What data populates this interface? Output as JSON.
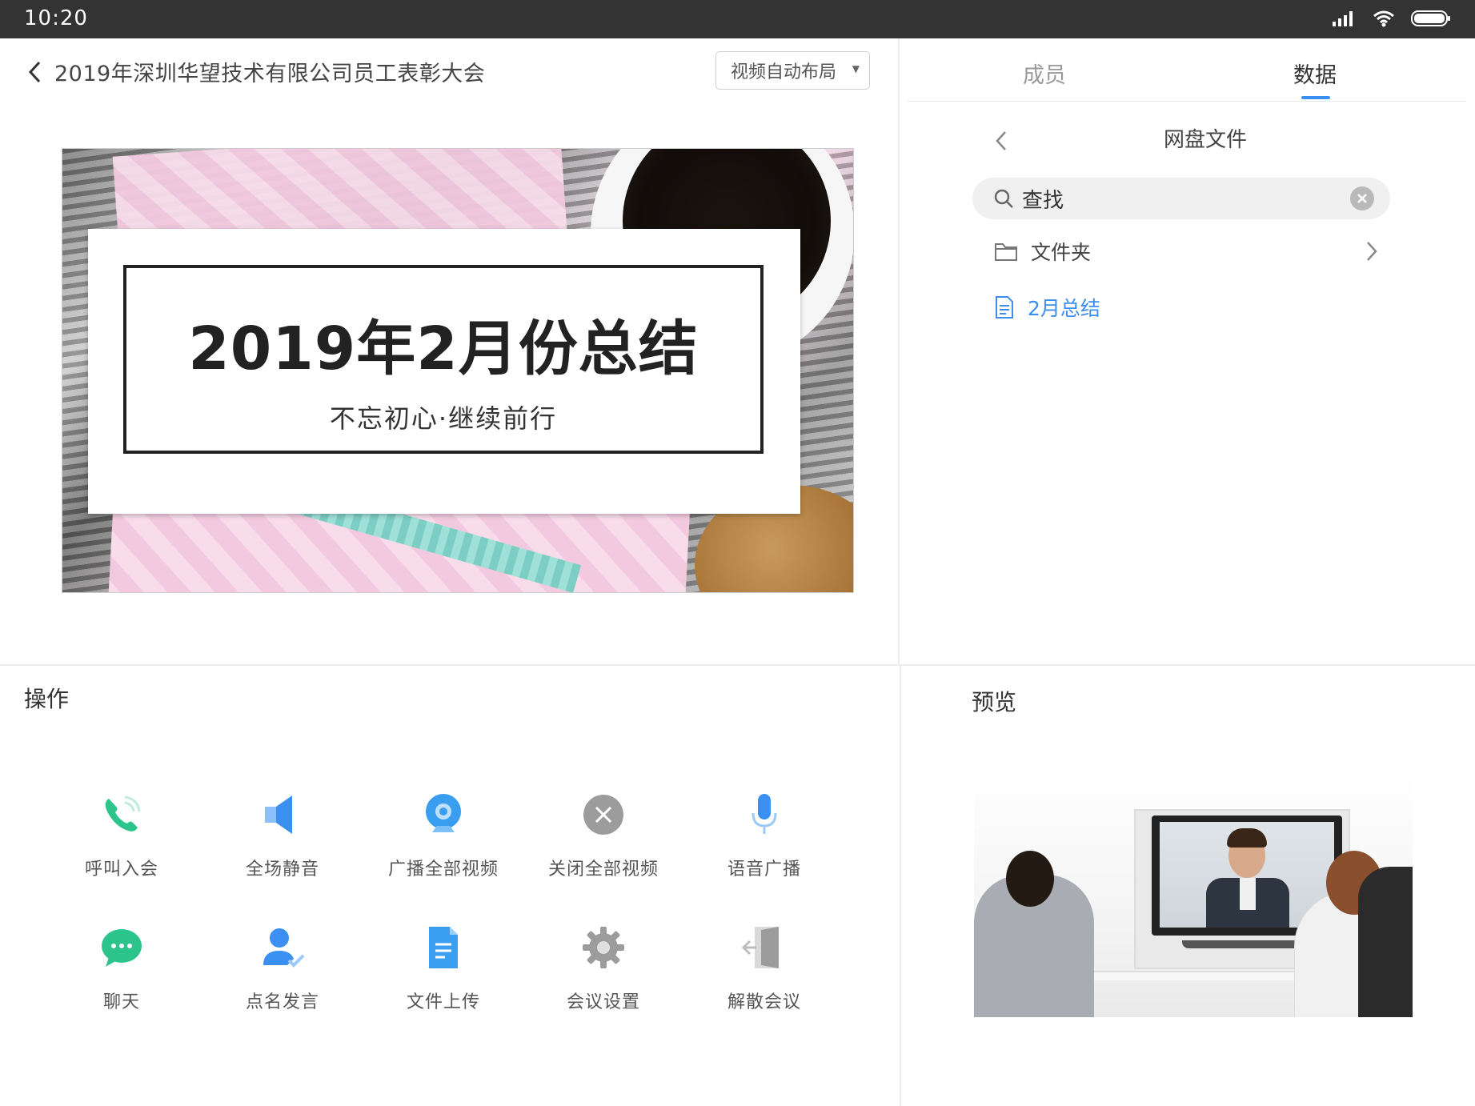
{
  "status": {
    "time": "10:20",
    "icons": [
      "signal-icon",
      "wifi-icon",
      "battery-icon"
    ]
  },
  "header": {
    "title": "2019年深圳华望技术有限公司员工表彰大会",
    "layout_select": "视频自动布局"
  },
  "slide": {
    "title": "2019年2月份总结",
    "subtitle": "不忘初心·继续前行"
  },
  "right_panel": {
    "tabs": [
      {
        "label": "成员",
        "active": false
      },
      {
        "label": "数据",
        "active": true
      }
    ],
    "netdisk": {
      "title": "网盘文件",
      "search_placeholder": "查找",
      "items": [
        {
          "label": "文件夹",
          "type": "folder"
        },
        {
          "label": "2月总结",
          "type": "file"
        }
      ]
    }
  },
  "operations": {
    "title": "操作",
    "items": [
      {
        "label": "呼叫入会",
        "icon": "phone-call-icon",
        "color": "#2cc48b"
      },
      {
        "label": "全场静音",
        "icon": "speaker-mute-icon",
        "color": "#3a8ff0"
      },
      {
        "label": "广播全部视频",
        "icon": "webcam-icon",
        "color": "#3a9ef0"
      },
      {
        "label": "关闭全部视频",
        "icon": "close-circle-icon",
        "color": "#9c9c9c"
      },
      {
        "label": "语音广播",
        "icon": "microphone-icon",
        "color": "#3a8ff0"
      },
      {
        "label": "聊天",
        "icon": "chat-bubble-icon",
        "color": "#2cc48b"
      },
      {
        "label": "点名发言",
        "icon": "user-check-icon",
        "color": "#3a8ff0"
      },
      {
        "label": "文件上传",
        "icon": "document-icon",
        "color": "#3a9ef0"
      },
      {
        "label": "会议设置",
        "icon": "gear-icon",
        "color": "#9c9c9c"
      },
      {
        "label": "解散会议",
        "icon": "exit-door-icon",
        "color": "#9c9c9c"
      }
    ]
  },
  "preview": {
    "title": "预览"
  },
  "colors": {
    "accent": "#3a8ff0",
    "green": "#2cc48b",
    "gray": "#9c9c9c",
    "status_bar": "#333333"
  }
}
